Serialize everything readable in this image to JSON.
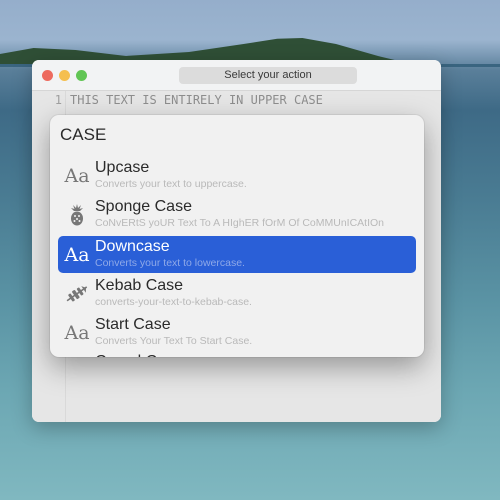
{
  "window": {
    "title": "Select your action",
    "traffic_lights": [
      "close",
      "minimize",
      "zoom"
    ]
  },
  "editor": {
    "line_number": "1",
    "line_text": "THIS TEXT IS ENTIRELY IN UPPER CASE"
  },
  "popup": {
    "header": "CASE",
    "selected_index": 2,
    "accent_color": "#2a5fd7",
    "items": [
      {
        "label": "Upcase",
        "description": "Converts your text to uppercase.",
        "icon": "text-case-icon"
      },
      {
        "label": "Sponge Case",
        "description": "CoNvERtS yoUR Text To A HIghER fOrM Of CoMMUnICAtIOn",
        "icon": "pineapple-icon"
      },
      {
        "label": "Downcase",
        "description": "Converts your text to lowercase.",
        "icon": "text-case-icon"
      },
      {
        "label": "Kebab Case",
        "description": "converts-your-text-to-kebab-case.",
        "icon": "kebab-skewer-icon"
      },
      {
        "label": "Start Case",
        "description": "Converts Your Text To Start Case.",
        "icon": "text-case-icon"
      },
      {
        "label": "Camel Case",
        "description": "",
        "icon": "text-case-icon"
      }
    ],
    "icon_glyph": "Aa"
  }
}
